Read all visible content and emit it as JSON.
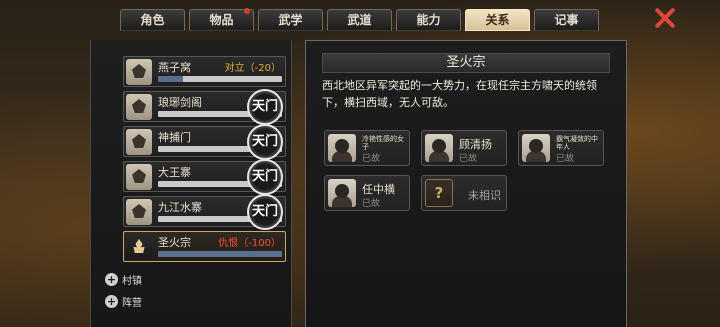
{
  "tabs": [
    {
      "label": "角色",
      "active": false,
      "badge": false
    },
    {
      "label": "物品",
      "active": false,
      "badge": true
    },
    {
      "label": "武学",
      "active": false,
      "badge": false
    },
    {
      "label": "武道",
      "active": false,
      "badge": false
    },
    {
      "label": "能力",
      "active": false,
      "badge": false
    },
    {
      "label": "关系",
      "active": true,
      "badge": false
    },
    {
      "label": "记事",
      "active": false,
      "badge": false
    }
  ],
  "close_icon": "close-x-icon",
  "sects": [
    {
      "name": "燕子窝",
      "status": "对立（-20）",
      "status_color": "#e0b22e",
      "bar": 0.2,
      "seal": ""
    },
    {
      "name": "琅琊剑阁",
      "status": "",
      "status_color": "",
      "bar": 0.0,
      "seal": "天门"
    },
    {
      "name": "神捕门",
      "status": "",
      "status_color": "",
      "bar": 0.0,
      "seal": "天门"
    },
    {
      "name": "大王寨",
      "status": "",
      "status_color": "",
      "bar": 0.0,
      "seal": "天门"
    },
    {
      "name": "九江水寨",
      "status": "",
      "status_color": "",
      "bar": 0.0,
      "seal": "天门"
    },
    {
      "name": "圣火宗",
      "status": "仇恨（-100）",
      "status_color": "#ff4a36",
      "bar": 1.0,
      "seal": "",
      "active": true
    }
  ],
  "expanders": [
    "村镇",
    "阵营"
  ],
  "detail": {
    "title": "圣火宗",
    "description": "西北地区异军突起的一大势力，在现任宗主方啸天的统领下，横扫西域，无人可敌。",
    "members": [
      {
        "name": "冷艳性感的女子",
        "status": "已故",
        "small": true,
        "known": true
      },
      {
        "name": "顾清扬",
        "status": "已故",
        "small": false,
        "known": true
      },
      {
        "name": "霸气凝敛的中年人",
        "status": "已故",
        "small": true,
        "known": true
      },
      {
        "name": "任中横",
        "status": "已故",
        "small": false,
        "known": true
      },
      {
        "name": "未相识",
        "status": "",
        "small": false,
        "known": false
      }
    ]
  }
}
